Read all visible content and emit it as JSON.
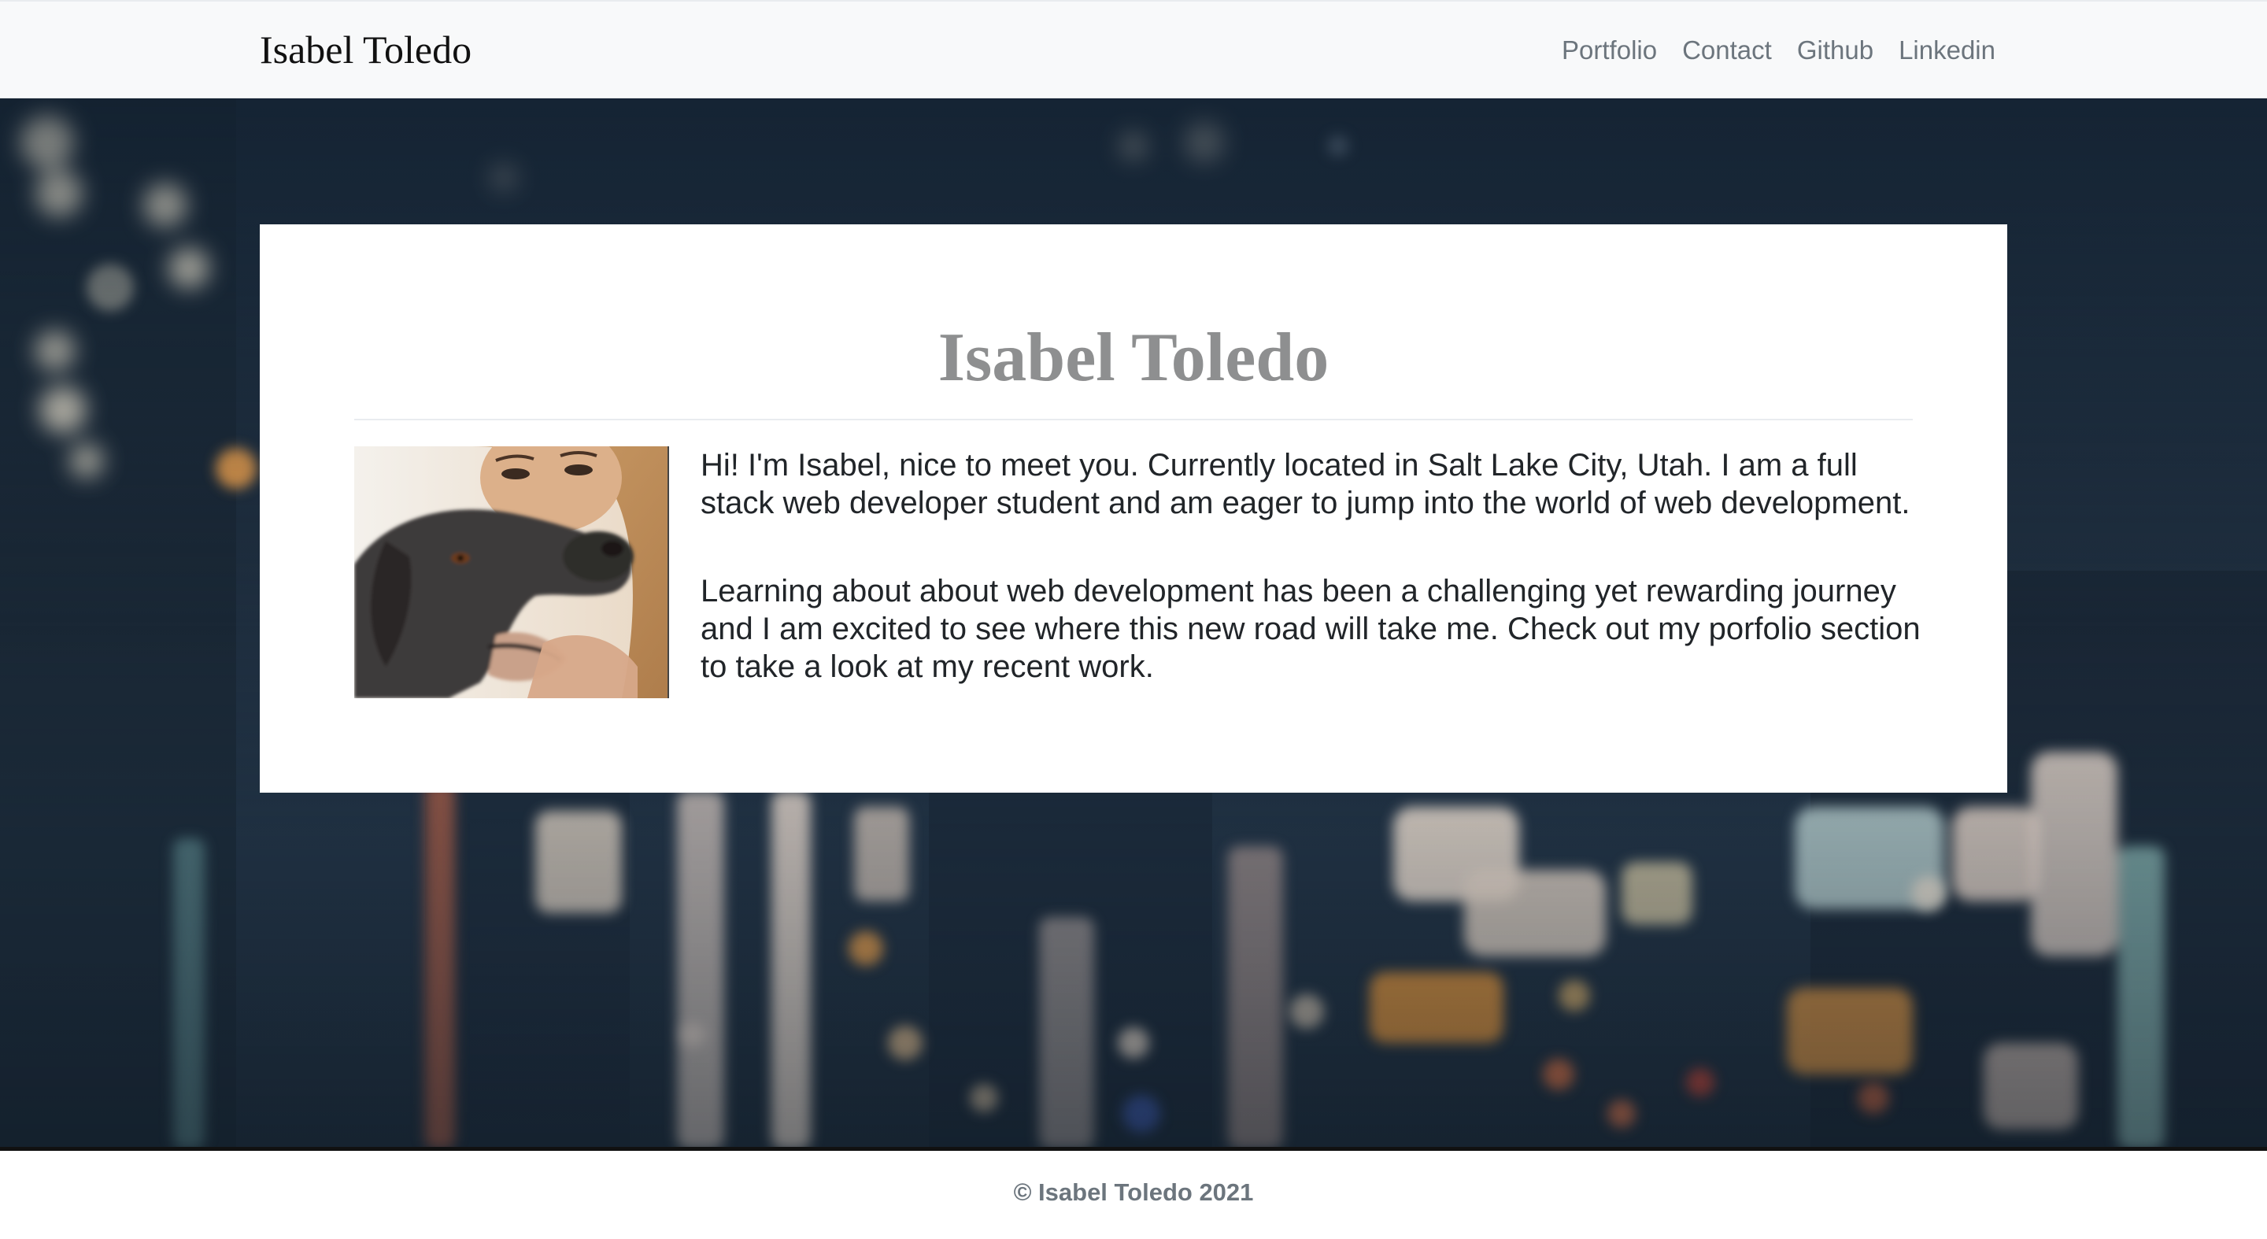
{
  "navbar": {
    "brand": "Isabel Toledo",
    "links": [
      {
        "label": "Portfolio"
      },
      {
        "label": "Contact"
      },
      {
        "label": "Github"
      },
      {
        "label": "Linkedin"
      }
    ]
  },
  "about": {
    "title": "Isabel Toledo",
    "paragraphs": [
      "Hi! I'm Isabel, nice to meet you. Currently located in Salt Lake City, Utah. I am a full stack web developer student and am eager to jump into the world of web development.",
      "Learning about about web development has been a challenging yet rewarding journey and I am excited to see where this new road will take me. Check out my porfolio section to take a look at my recent work."
    ]
  },
  "footer": {
    "text": "© Isabel Toledo 2021"
  },
  "icons": {
    "background": "blurred-city-lights-image",
    "profile": "woman-with-dog-photo"
  },
  "colors": {
    "navbar_bg": "#f8f9fa",
    "nav_link": "#6c757d",
    "title": "#8e8f90",
    "hero_bg": "#1a2a3a"
  }
}
